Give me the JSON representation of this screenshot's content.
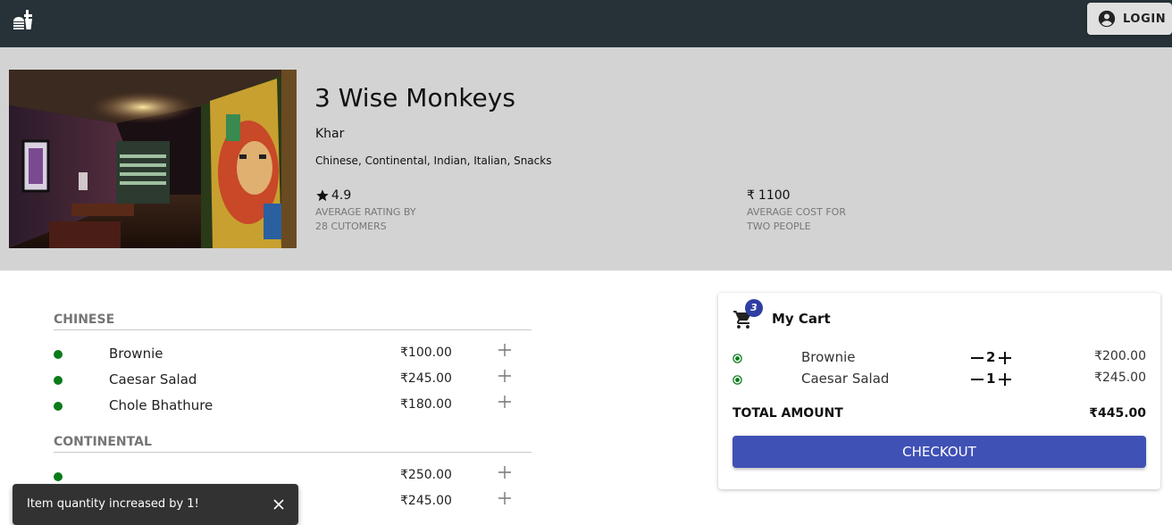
{
  "header": {
    "login_label": "LOGIN"
  },
  "restaurant": {
    "name": "3 Wise Monkeys",
    "locality": "Khar",
    "cuisines": "Chinese, Continental, Indian, Italian, Snacks",
    "rating": "4.9",
    "rating_label_line1": "AVERAGE RATING BY",
    "rating_label_line2": "28 CUTOMERS",
    "avg_cost": "1100",
    "cost_label_line1": "AVERAGE COST FOR",
    "cost_label_line2": "TWO PEOPLE"
  },
  "menu": {
    "categories": [
      {
        "name": "CHINESE",
        "items": [
          {
            "name": "Brownie",
            "price": "100.00"
          },
          {
            "name": "Caesar Salad",
            "price": "245.00"
          },
          {
            "name": "Chole Bhathure",
            "price": "180.00"
          }
        ]
      },
      {
        "name": "CONTINENTAL",
        "items": [
          {
            "name": "",
            "price": "250.00"
          },
          {
            "name": "",
            "price": "245.00"
          }
        ]
      }
    ]
  },
  "cart": {
    "title": "My Cart",
    "badge_count": "3",
    "items": [
      {
        "name": "Brownie",
        "qty": "2",
        "price": "200.00"
      },
      {
        "name": "Caesar Salad",
        "qty": "1",
        "price": "245.00"
      }
    ],
    "total_label": "TOTAL AMOUNT",
    "total_value": "445.00",
    "checkout_label": "CHECKOUT"
  },
  "snackbar": {
    "message": "Item quantity increased by 1!"
  },
  "currency_symbol": "₹",
  "colors": {
    "topbar": "#263238",
    "hero_bg": "#d3d3d3",
    "veg_dot": "#0a7a1a",
    "accent": "#3f51b5",
    "badge": "#2f3ea3"
  }
}
